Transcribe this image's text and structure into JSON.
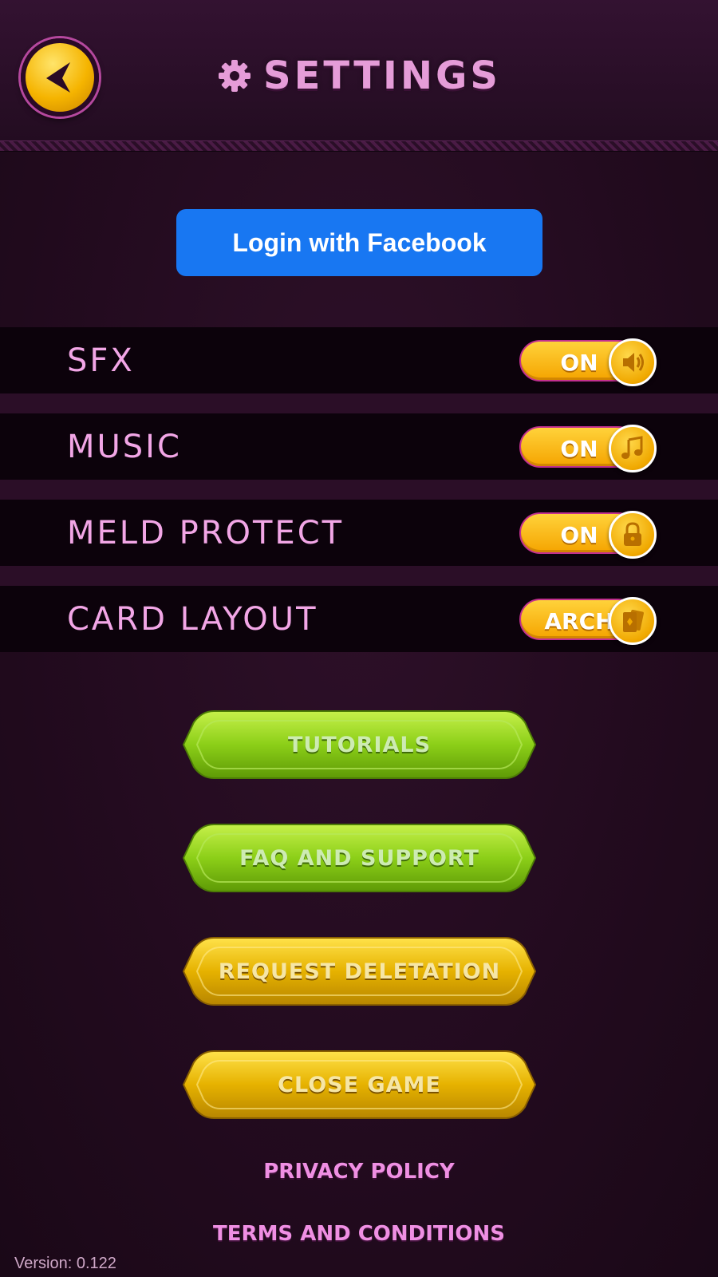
{
  "header": {
    "title": "SETTINGS",
    "back_icon": "back-arrow-icon",
    "title_icon": "gear-icon"
  },
  "facebook": {
    "label": "Login with Facebook",
    "color": "#1877f2"
  },
  "settings": [
    {
      "label": "SFX",
      "value": "ON",
      "icon": "speaker-icon"
    },
    {
      "label": "MUSIC",
      "value": "ON",
      "icon": "music-note-icon"
    },
    {
      "label": "MELD PROTECT",
      "value": "ON",
      "icon": "lock-icon"
    },
    {
      "label": "CARD LAYOUT",
      "value": "ARCH",
      "icon": "cards-icon"
    }
  ],
  "buttons": [
    {
      "label": "TUTORIALS",
      "color": "green"
    },
    {
      "label": "FAQ AND SUPPORT",
      "color": "green"
    },
    {
      "label": "REQUEST DELETATION",
      "color": "yellow"
    },
    {
      "label": "CLOSE GAME",
      "color": "yellow"
    }
  ],
  "footer": {
    "privacy": "PRIVACY POLICY",
    "terms": "TERMS AND CONDITIONS",
    "version": "Version: 0.122"
  },
  "colors": {
    "accent_pink": "#e59cd8",
    "toggle_yellow": "#ffc21a",
    "button_green": "#8fd11a",
    "button_yellow": "#f0b800"
  }
}
